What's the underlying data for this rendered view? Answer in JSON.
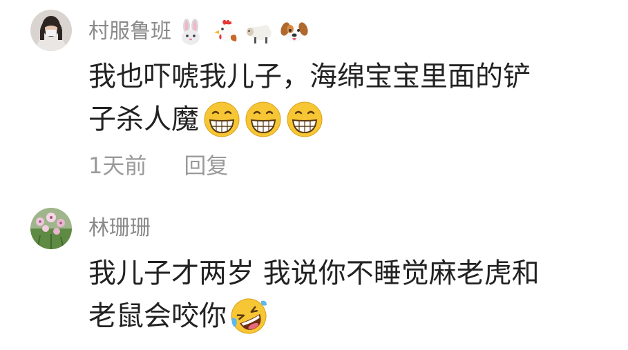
{
  "comments": [
    {
      "username": "村服鲁班",
      "username_emojis": [
        "rabbit-face-icon",
        "rooster-icon",
        "sheep-icon",
        "dog-face-icon"
      ],
      "text_line1": "我也吓唬我儿子，海绵宝宝里面的铲",
      "text_line2": "子杀人魔",
      "text_emojis": [
        "grinning-face-icon",
        "grinning-face-icon",
        "grinning-face-icon"
      ],
      "time": "1天前",
      "reply_label": "回复"
    },
    {
      "username": "林珊珊",
      "text_line1": "我儿子才两岁 我说你不睡觉麻老虎和",
      "text_line2": "老鼠会咬你",
      "text_emojis": [
        "rolling-on-floor-laughing-icon"
      ]
    }
  ],
  "colors": {
    "username": "#8a8a8a",
    "text": "#222222",
    "meta": "#9a9a9a",
    "emoji_yellow": "#f7c634"
  }
}
